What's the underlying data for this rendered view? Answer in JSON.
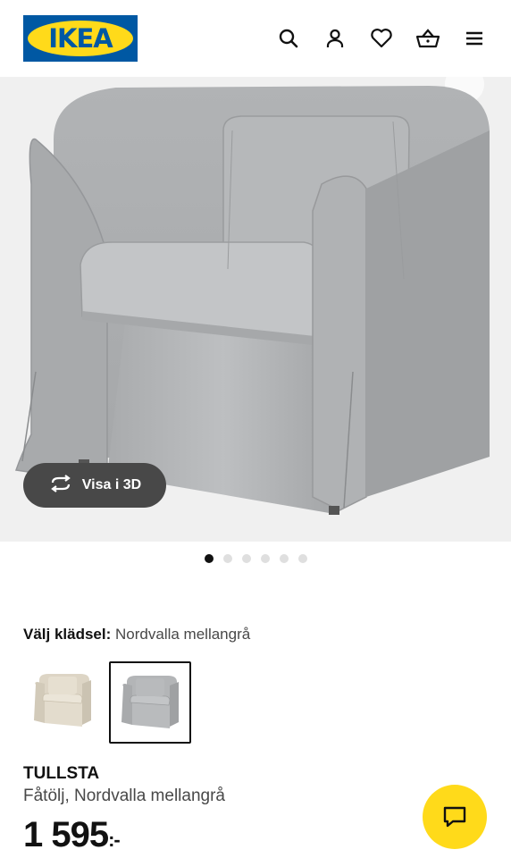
{
  "header": {
    "logo_text": "IKEA",
    "icons": [
      "search-icon",
      "user-icon",
      "heart-icon",
      "basket-icon",
      "menu-icon"
    ]
  },
  "gallery": {
    "view_3d_label": "Visa i 3D",
    "image_count": 6,
    "active_index": 0
  },
  "upholstery": {
    "label": "Välj klädsel:",
    "value": "Nordvalla mellangrå",
    "options": [
      "beige",
      "mellangrå"
    ],
    "selected_index": 1
  },
  "product": {
    "name": "TULLSTA",
    "description": "Fåtölj, Nordvalla mellangrå",
    "price": "1 595",
    "currency": ":-"
  },
  "colors": {
    "ikea_blue": "#0058a3",
    "ikea_yellow": "#ffda1a",
    "button_dark": "#484848"
  }
}
